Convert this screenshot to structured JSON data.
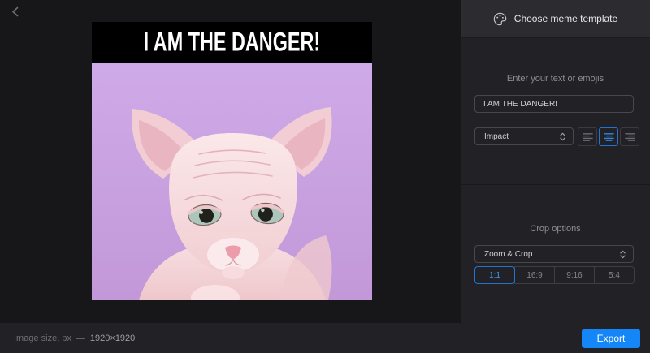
{
  "window": {
    "back_icon": "chevron-left"
  },
  "meme": {
    "caption": "I AM THE DANGER!",
    "bar_color": "#000000",
    "photo_bg": "#c7a2df",
    "photo_subject": "sphynx-cat"
  },
  "sidebar": {
    "header": {
      "icon": "palette",
      "title": "Choose meme template"
    },
    "text_section": {
      "label": "Enter your text or emojis",
      "input": {
        "value": "I AM THE DANGER!"
      },
      "font_select": {
        "value": "Impact"
      },
      "alignment": {
        "options": [
          {
            "id": "left",
            "selected": false
          },
          {
            "id": "center",
            "selected": true
          },
          {
            "id": "right",
            "selected": false
          }
        ]
      }
    },
    "crop_section": {
      "label": "Crop options",
      "mode_select": {
        "value": "Zoom & Crop"
      },
      "ratios": [
        {
          "label": "1:1",
          "selected": true
        },
        {
          "label": "16:9",
          "selected": false
        },
        {
          "label": "9:16",
          "selected": false
        },
        {
          "label": "5:4",
          "selected": false
        }
      ]
    }
  },
  "bottombar": {
    "size_label": "Image size, px",
    "separator": "—",
    "size_value": "1920×1920",
    "export_label": "Export"
  },
  "colors": {
    "accent": "#1486f8",
    "selected_blue": "#2373d5",
    "canvas_bg": "#17171a",
    "panel_bg": "#222226",
    "header_bg": "#2c2c30"
  }
}
